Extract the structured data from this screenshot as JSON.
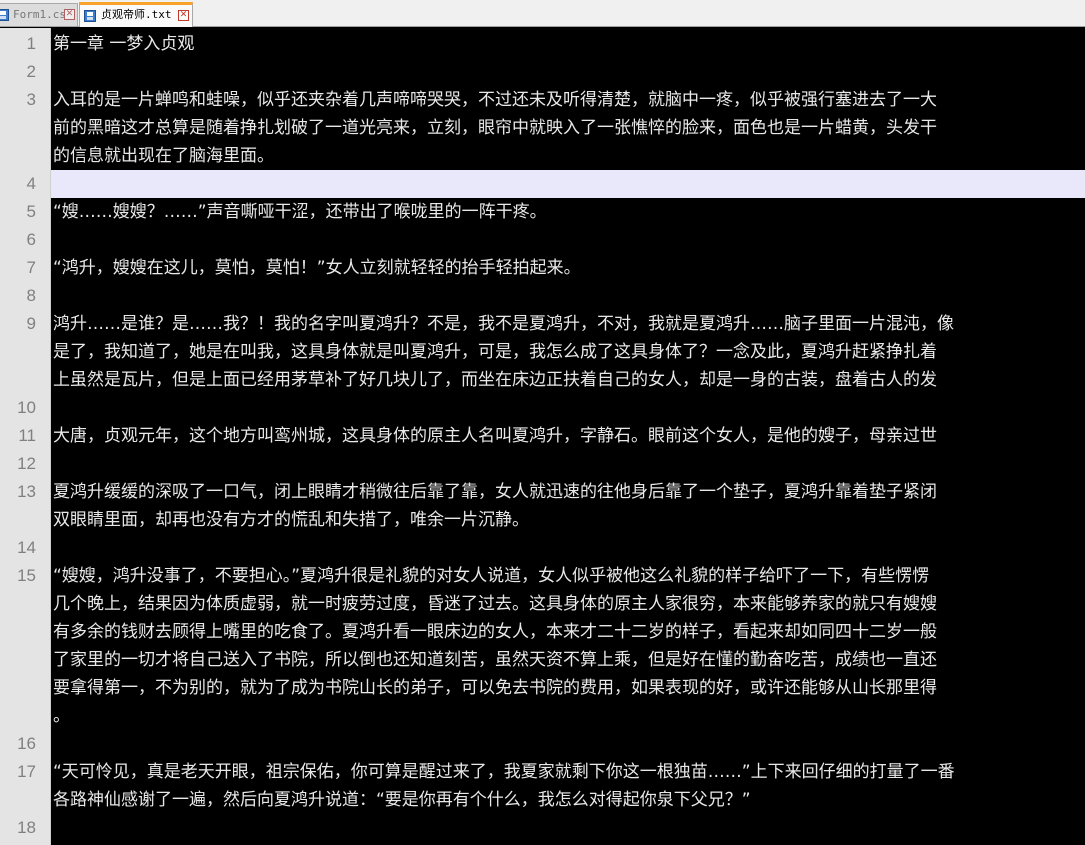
{
  "tabs": [
    {
      "label": "Form1.cs",
      "active": false
    },
    {
      "label": "贞观帝师.txt",
      "active": true
    }
  ],
  "editor": {
    "current_line_number": 4,
    "lines": [
      {
        "n": "1",
        "rows": [
          "第一章 一梦入贞观"
        ]
      },
      {
        "n": "2",
        "rows": [
          ""
        ]
      },
      {
        "n": "3",
        "rows": [
          "入耳的是一片蝉鸣和蛙噪，似乎还夹杂着几声啼啼哭哭，不过还未及听得清楚，就脑中一疼，似乎被强行塞进去了一大",
          "前的黑暗这才总算是随着挣扎划破了一道光亮来，立刻，眼帘中就映入了一张憔悴的脸来，面色也是一片蜡黄，头发干",
          "的信息就出现在了脑海里面。"
        ]
      },
      {
        "n": "4",
        "rows": [
          ""
        ]
      },
      {
        "n": "5",
        "rows": [
          "“嫂……嫂嫂？……”声音嘶哑干涩，还带出了喉咙里的一阵干疼。"
        ]
      },
      {
        "n": "6",
        "rows": [
          ""
        ]
      },
      {
        "n": "7",
        "rows": [
          "“鸿升，嫂嫂在这儿，莫怕，莫怕！”女人立刻就轻轻的抬手轻拍起来。"
        ]
      },
      {
        "n": "8",
        "rows": [
          ""
        ]
      },
      {
        "n": "9",
        "rows": [
          "鸿升……是谁？是……我？！我的名字叫夏鸿升？不是，我不是夏鸿升，不对，我就是夏鸿升……脑子里面一片混沌，像",
          "是了，我知道了，她是在叫我，这具身体就是叫夏鸿升，可是，我怎么成了这具身体了？一念及此，夏鸿升赶紧挣扎着",
          "上虽然是瓦片，但是上面已经用茅草补了好几块儿了，而坐在床边正扶着自己的女人，却是一身的古装，盘着古人的发"
        ]
      },
      {
        "n": "10",
        "rows": [
          ""
        ]
      },
      {
        "n": "11",
        "rows": [
          "大唐，贞观元年，这个地方叫鸾州城，这具身体的原主人名叫夏鸿升，字静石。眼前这个女人，是他的嫂子，母亲过世"
        ]
      },
      {
        "n": "12",
        "rows": [
          ""
        ]
      },
      {
        "n": "13",
        "rows": [
          "夏鸿升缓缓的深吸了一口气，闭上眼睛才稍微往后靠了靠，女人就迅速的往他身后靠了一个垫子，夏鸿升靠着垫子紧闭",
          "双眼睛里面，却再也没有方才的慌乱和失措了，唯余一片沉静。"
        ]
      },
      {
        "n": "14",
        "rows": [
          ""
        ]
      },
      {
        "n": "15",
        "rows": [
          "“嫂嫂，鸿升没事了，不要担心。”夏鸿升很是礼貌的对女人说道，女人似乎被他这么礼貌的样子给吓了一下，有些愣愣",
          "几个晚上，结果因为体质虚弱，就一时疲劳过度，昏迷了过去。这具身体的原主人家很穷，本来能够养家的就只有嫂嫂",
          "有多余的钱财去顾得上嘴里的吃食了。夏鸿升看一眼床边的女人，本来才二十二岁的样子，看起来却如同四十二岁一般",
          "了家里的一切才将自己送入了书院，所以倒也还知道刻苦，虽然天资不算上乘，但是好在懂的勤奋吃苦，成绩也一直还",
          "要拿得第一，不为别的，就为了成为书院山长的弟子，可以免去书院的费用，如果表现的好，或许还能够从山长那里得",
          "。"
        ]
      },
      {
        "n": "16",
        "rows": [
          ""
        ]
      },
      {
        "n": "17",
        "rows": [
          "“天可怜见，真是老天开眼，祖宗保佑，你可算是醒过来了，我夏家就剩下你这一根独苗……”上下来回仔细的打量了一番",
          "各路神仙感谢了一遍，然后向夏鸿升说道：“要是你再有个什么，我怎么对得起你泉下父兄？”"
        ]
      },
      {
        "n": "18",
        "rows": [
          ""
        ]
      }
    ]
  }
}
